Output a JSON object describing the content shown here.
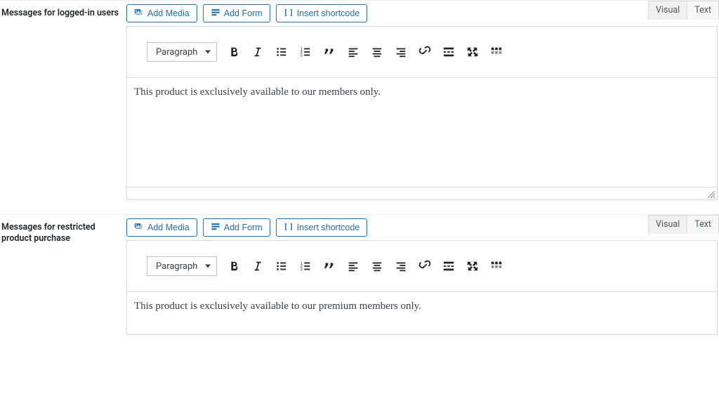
{
  "sections": [
    {
      "label": "Messages for logged-in users",
      "content": "This product is exclusively available to our members only."
    },
    {
      "label": "Messages for restricted product purchase",
      "content": "This product is exclusively available to our premium members only."
    }
  ],
  "buttons": {
    "add_media": "Add Media",
    "add_form": "Add Form",
    "insert_shortcode": "Insert shortcode"
  },
  "tabs": {
    "visual": "Visual",
    "text": "Text"
  },
  "format_select": "Paragraph"
}
